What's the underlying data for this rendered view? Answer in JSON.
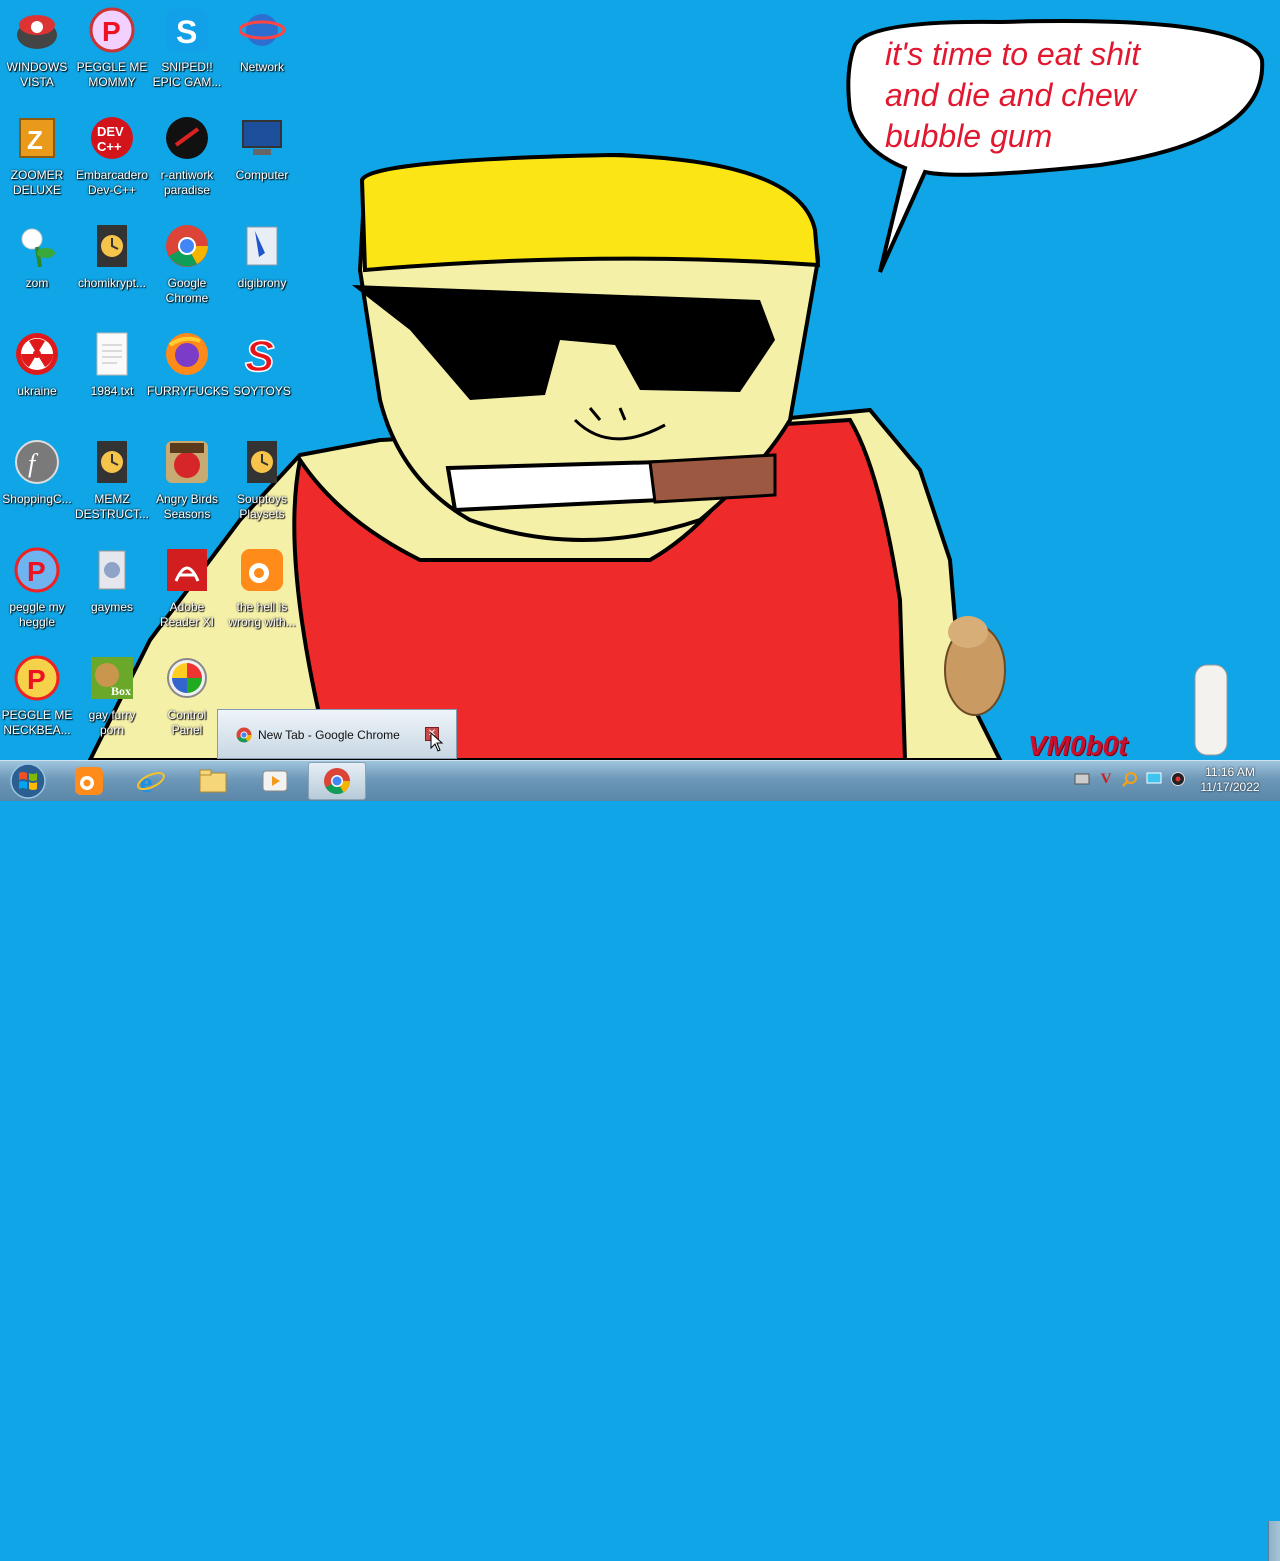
{
  "wallpaper": {
    "speech": "it's time to eat shit\nand die and chew\nbubble gum",
    "watermark": "VM0b0t"
  },
  "desktop_icons": [
    {
      "label": "WINDOWS\nVISTA",
      "icon": "windows-vista-icon"
    },
    {
      "label": "PEGGLE ME\nMOMMY",
      "icon": "peggle-icon"
    },
    {
      "label": "SNIPED!!\nEPIC GAM...",
      "icon": "skype-icon"
    },
    {
      "label": "Network",
      "icon": "network-icon"
    },
    {
      "label": "ZOOMER\nDELUXE",
      "icon": "zoomer-deluxe-icon"
    },
    {
      "label": "Embarcadero\nDev-C++",
      "icon": "dev-cpp-icon"
    },
    {
      "label": "r-antiwork\nparadise",
      "icon": "antiwork-icon"
    },
    {
      "label": "Computer",
      "icon": "computer-icon"
    },
    {
      "label": "zom",
      "icon": "plant-icon"
    },
    {
      "label": "chomikrypt...",
      "icon": "clock-file-icon"
    },
    {
      "label": "Google\nChrome",
      "icon": "chrome-icon"
    },
    {
      "label": "digibrony",
      "icon": "digibrony-icon"
    },
    {
      "label": "ukraine",
      "icon": "radiation-icon"
    },
    {
      "label": "1984.txt",
      "icon": "text-file-icon"
    },
    {
      "label": "FURRYFUCKS",
      "icon": "firefox-icon"
    },
    {
      "label": "SOYTOYS",
      "icon": "soytoys-icon"
    },
    {
      "label": "ShoppingC...",
      "icon": "flash-icon"
    },
    {
      "label": "MEMZ\nDESTRUCT...",
      "icon": "clock-file-icon"
    },
    {
      "label": "Angry Birds\nSeasons",
      "icon": "angry-birds-icon"
    },
    {
      "label": "Souptoys\nPlaysets",
      "icon": "clock-file-icon"
    },
    {
      "label": "peggle my\nheggle",
      "icon": "peggle-icon"
    },
    {
      "label": "gaymes",
      "icon": "games-folder-icon"
    },
    {
      "label": "Adobe\nReader XI",
      "icon": "adobe-reader-icon"
    },
    {
      "label": "the hell is\nwrong with...",
      "icon": "uc-browser-icon"
    },
    {
      "label": "PEGGLE ME\nNECKBEA...",
      "icon": "peggle-icon"
    },
    {
      "label": "gay furry\nporn",
      "icon": "hamster-box-icon"
    },
    {
      "label": "Control\nPanel",
      "icon": "control-panel-icon"
    }
  ],
  "taskbar": {
    "items": [
      {
        "name": "uc-browser",
        "icon": "uc-browser-icon"
      },
      {
        "name": "internet-explorer",
        "icon": "ie-icon"
      },
      {
        "name": "file-explorer",
        "icon": "folder-icon"
      },
      {
        "name": "media-player",
        "icon": "media-player-icon"
      },
      {
        "name": "google-chrome",
        "icon": "chrome-icon",
        "active": true
      }
    ],
    "clock_time": "11:16 AM",
    "clock_date": "11/17/2022"
  },
  "preview": {
    "title": "New Tab - Google Chrome"
  }
}
